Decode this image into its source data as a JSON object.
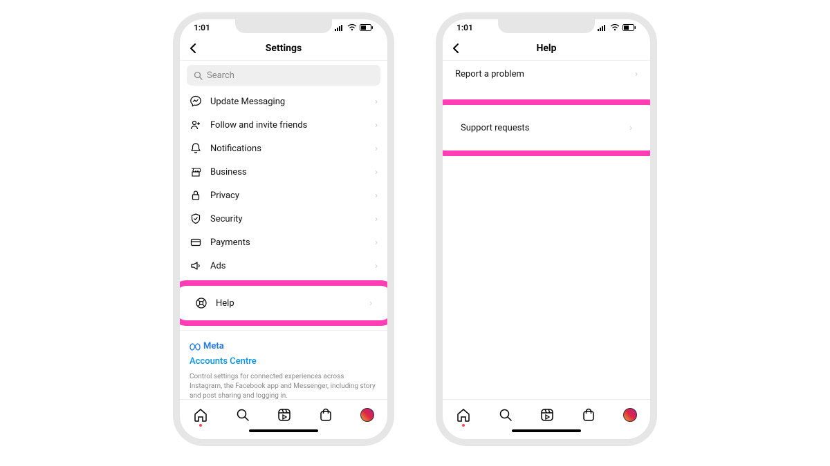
{
  "status": {
    "time": "1:01"
  },
  "phone1": {
    "header_title": "Settings",
    "search_placeholder": "Search",
    "rows": [
      {
        "icon": "messenger",
        "label": "Update Messaging"
      },
      {
        "icon": "invite",
        "label": "Follow and invite friends"
      },
      {
        "icon": "bell",
        "label": "Notifications"
      },
      {
        "icon": "store",
        "label": "Business"
      },
      {
        "icon": "lock",
        "label": "Privacy"
      },
      {
        "icon": "shield",
        "label": "Security"
      },
      {
        "icon": "card",
        "label": "Payments"
      },
      {
        "icon": "ads",
        "label": "Ads"
      }
    ],
    "help_row": {
      "icon": "help",
      "label": "Help"
    },
    "meta_label": "Meta",
    "accounts_centre": "Accounts Centre",
    "meta_desc": "Control settings for connected experiences across Instagram, the Facebook app and Messenger, including story and post sharing and logging in."
  },
  "phone2": {
    "header_title": "Help",
    "rows": [
      {
        "label": "Report a problem"
      }
    ],
    "highlighted": {
      "label": "Support requests"
    }
  },
  "highlight_color": "#ff3eb5"
}
